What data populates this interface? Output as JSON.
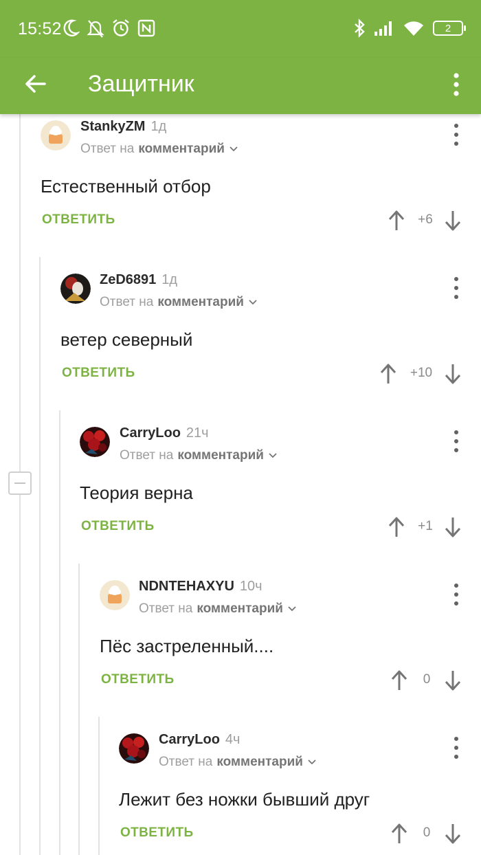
{
  "status_bar": {
    "time": "15:52",
    "left_icons": [
      "moon-icon",
      "bell-off-icon",
      "alarm-icon",
      "nfc-icon"
    ],
    "right_icons": [
      "bluetooth-icon",
      "signal-icon",
      "wifi-icon",
      "battery-icon"
    ],
    "battery_level": "2"
  },
  "app_bar": {
    "title": "Защитник",
    "color": "#7cb342"
  },
  "reply_prefix": "Ответ на",
  "reply_target": "комментарий",
  "reply_label": "ОТВЕТИТЬ",
  "comments": [
    {
      "author": "StankyZM",
      "time": "1д",
      "text": "Естественный отбор",
      "rating": "+6",
      "avatar": "default-avatar"
    },
    {
      "author": "ZeD6891",
      "time": "1д",
      "text": "ветер северный",
      "rating": "+10",
      "avatar": "user-photo-avatar"
    },
    {
      "author": "CarryLoo",
      "time": "21ч",
      "text": "Теория верна",
      "rating": "+1",
      "avatar": "roses-avatar"
    },
    {
      "author": "NDNTEHAXYU",
      "time": "10ч",
      "text": "Пёс застреленный....",
      "rating": "0",
      "avatar": "default-avatar"
    },
    {
      "author": "CarryLoo",
      "time": "4ч",
      "text": "Лежит без ножки бывший друг",
      "rating": "0",
      "avatar": "roses-avatar"
    }
  ]
}
